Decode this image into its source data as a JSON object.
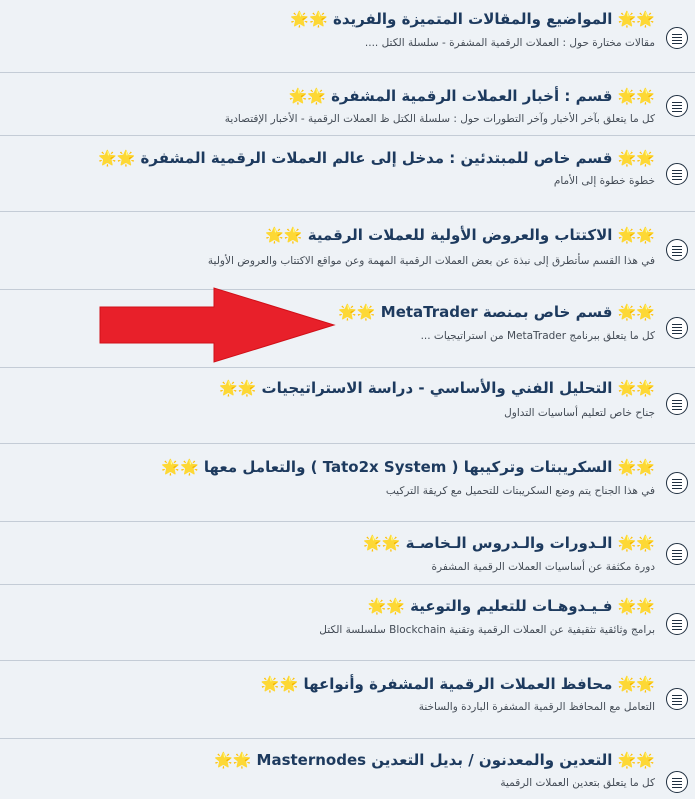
{
  "colors": {
    "row_background": "#eef2f6",
    "title_text": "#1d3a5e",
    "description_text": "#444c56",
    "arrow": "#e8202a"
  },
  "forums": [
    {
      "title": "🌟🌟 المواضيع والمقالات المتميزة والفريدة 🌟🌟",
      "description": "مقالات مختارة حول : العملات الرقمية المشفرة - سلسلة الكتل ...."
    },
    {
      "title": "🌟🌟 قسم : أخبار العملات الرقمية المشفرة 🌟🌟",
      "description": "كل ما يتعلق بآخر الأخبار وآخر التطورات حول : سلسلة الكتل ظ العملات الرقمية - الأخبار الإقتصادية"
    },
    {
      "title": "🌟🌟 قسم خاص للمبتدئين : مدخل إلى عالم العملات الرقمية المشفرة 🌟🌟",
      "description": "خطوة خطوة إلى الأمام"
    },
    {
      "title": "🌟🌟 الاكتتاب والعروض الأولية للعملات الرقمية 🌟🌟",
      "description": "في هذا القسم سأتطرق إلى نبذة عن بعض العملات الرقمية المهمة وعن مواقع الاكتتاب والعروض الأولية"
    },
    {
      "title": "🌟🌟 قسم خاص بمنصة MetaTrader 🌟🌟",
      "description": "كل ما يتعلق ببرنامج MetaTrader من استراتيجيات ..."
    },
    {
      "title": "🌟🌟 التحليل الفني والأساسي - دراسة الاستراتيجيات 🌟🌟",
      "description": "جناح خاص لتعليم أساسيات التداول"
    },
    {
      "title": "🌟🌟 السكريبتات وتركيبها ( Tato2x System ) والتعامل معها 🌟🌟",
      "description": "في هذا الجناح يتم وضع السكريبتات للتحميل مع كريقة التركيب"
    },
    {
      "title": "🌟🌟 الـدورات والـدروس الـخاصـة 🌟🌟",
      "description": "دورة مكثفة عن أساسيات العملات الرقمية المشفرة"
    },
    {
      "title": "🌟🌟 فـيـدوهـات للتعليم والتوعية 🌟🌟",
      "description": "برامج وثائقية تثقيفية عن العملات الرقمية وتقنية Blockchain سلسلسة الكتل"
    },
    {
      "title": "🌟🌟 محافظ العملات الرقمية المشفرة وأنواعها 🌟🌟",
      "description": "التعامل مع المحافظ الرقمية المشفرة الباردة والساخنة"
    },
    {
      "title": "🌟🌟 التعدين والمعدنون / بديل التعدين Masternodes 🌟🌟",
      "description": "كل ما يتعلق بتعدين العملات الرقمية"
    }
  ]
}
